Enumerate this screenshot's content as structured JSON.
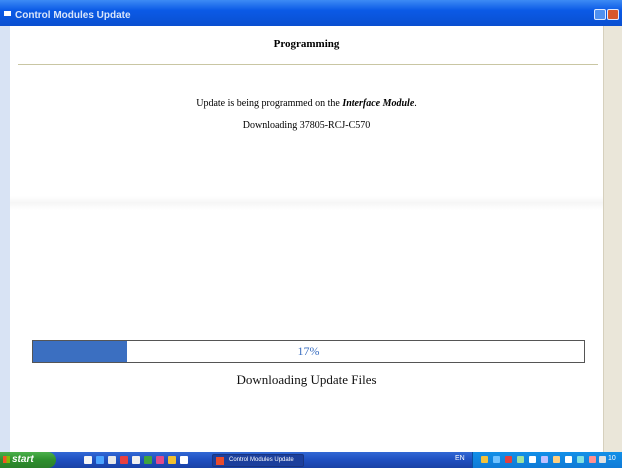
{
  "window": {
    "title": "Control Modules Update"
  },
  "header": {
    "title": "Programming"
  },
  "message": {
    "prefix": "Update is being programmed on the ",
    "module": "Interface Module",
    "suffix": "."
  },
  "status": {
    "downloading": "Downloading 37805-RCJ-C570"
  },
  "progress": {
    "percent": 17,
    "percent_label": "17%",
    "label": "Downloading Update Files"
  },
  "taskbar": {
    "start_label": "start",
    "task_label": "Control Modules Update",
    "language": "EN",
    "clock": "10"
  },
  "colors": {
    "progress_fill": "#3b6fc1",
    "titlebar": "#0b5ae6",
    "taskbar": "#1f4fc0",
    "start_button": "#2d8f2d"
  }
}
